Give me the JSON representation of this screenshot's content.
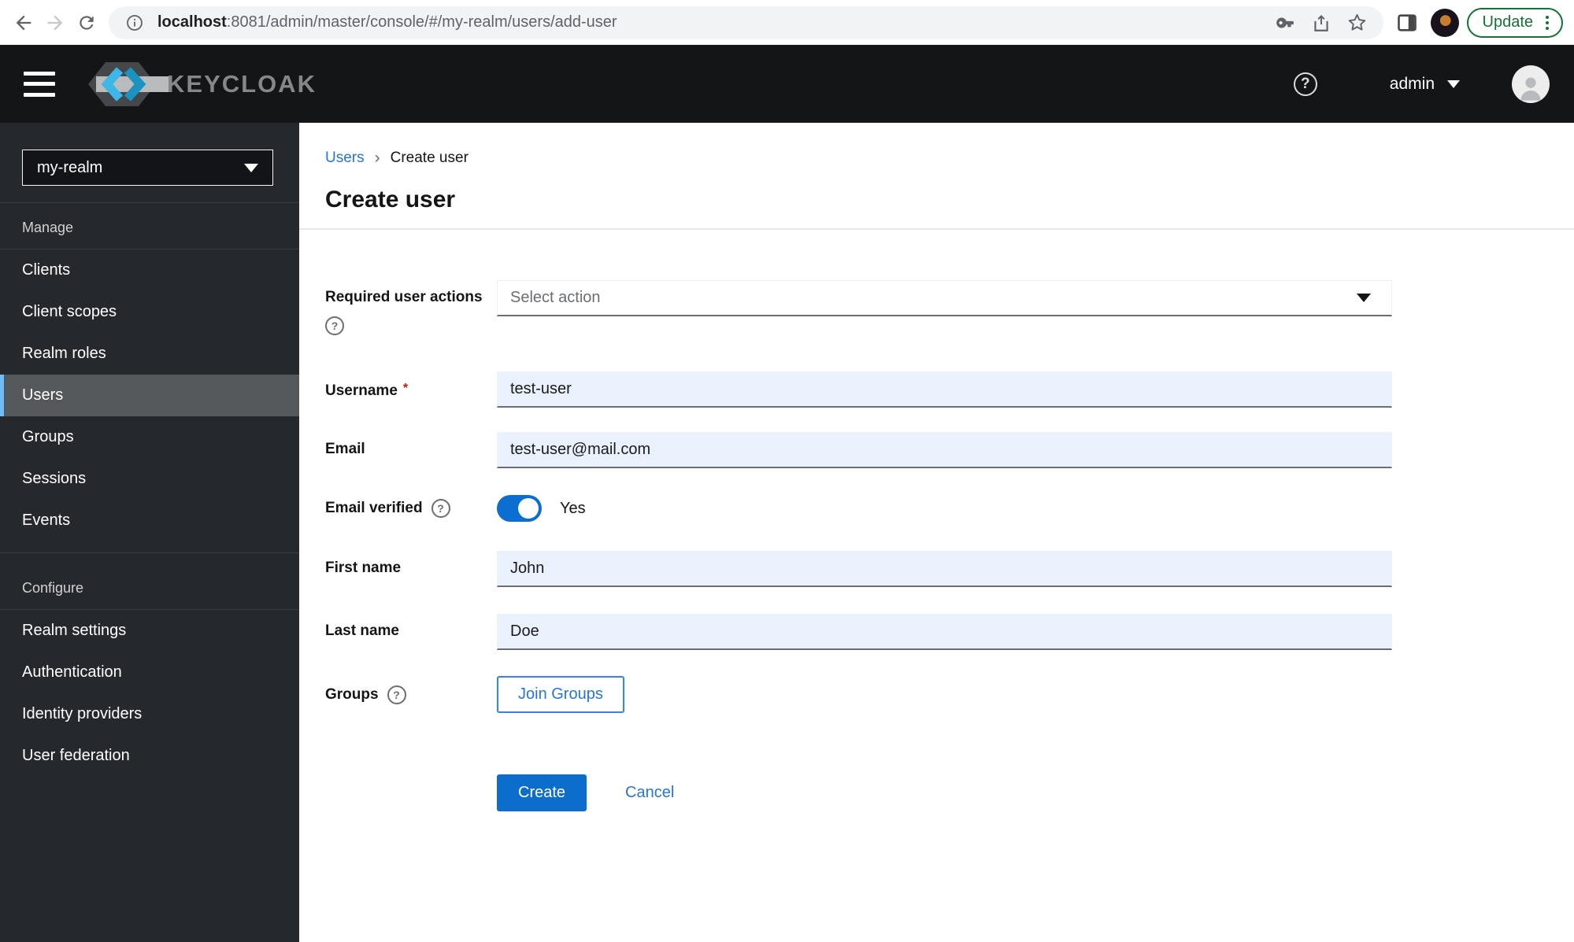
{
  "browser": {
    "url_host": "localhost",
    "url_rest": ":8081/admin/master/console/#/my-realm/users/add-user",
    "update_label": "Update"
  },
  "header": {
    "brand": "KEYCLOAK",
    "user": "admin"
  },
  "sidebar": {
    "realm": "my-realm",
    "groups": [
      {
        "title": "Manage",
        "items": [
          {
            "label": "Clients"
          },
          {
            "label": "Client scopes"
          },
          {
            "label": "Realm roles"
          },
          {
            "label": "Users",
            "current": true
          },
          {
            "label": "Groups"
          },
          {
            "label": "Sessions"
          },
          {
            "label": "Events"
          }
        ]
      },
      {
        "title": "Configure",
        "items": [
          {
            "label": "Realm settings"
          },
          {
            "label": "Authentication"
          },
          {
            "label": "Identity providers"
          },
          {
            "label": "User federation"
          }
        ]
      }
    ]
  },
  "breadcrumb": {
    "items": [
      "Users",
      "Create user"
    ]
  },
  "page": {
    "title": "Create user"
  },
  "form": {
    "required_user_actions": {
      "label": "Required user actions",
      "placeholder": "Select action"
    },
    "username": {
      "label": "Username",
      "value": "test-user",
      "required_marker": "*"
    },
    "email": {
      "label": "Email",
      "value": "test-user@mail.com"
    },
    "email_verified": {
      "label": "Email verified",
      "state": "Yes"
    },
    "first_name": {
      "label": "First name",
      "value": "John"
    },
    "last_name": {
      "label": "Last name",
      "value": "Doe"
    },
    "groups": {
      "label": "Groups",
      "button_label": "Join Groups"
    },
    "actions": {
      "create_label": "Create",
      "cancel_label": "Cancel"
    }
  },
  "icons": {
    "help_glyph": "?"
  },
  "colors": {
    "accent_blue": "#0d6dcd",
    "link_blue": "#2575dc",
    "nav_current_accent": "#73bcf7",
    "input_autofill_bg": "#e9f1fd",
    "update_green": "#137333",
    "required_red": "#c9190b",
    "header_bg": "#131517",
    "sidebar_bg": "#25282c"
  }
}
